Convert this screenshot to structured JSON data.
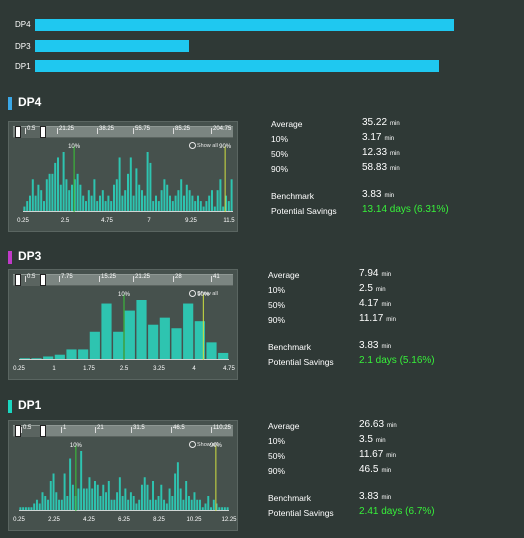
{
  "summary_bars": [
    {
      "label": "DP4",
      "fraction": 1.0
    },
    {
      "label": "DP3",
      "fraction": 0.367
    },
    {
      "label": "DP1",
      "fraction": 0.964
    }
  ],
  "sections": [
    {
      "title": "DP4",
      "color": "#3aa7e6",
      "slider_ticks": [
        "0.5",
        "21.25",
        "38.25",
        "55.75",
        "85.25",
        "204.75"
      ],
      "show_all": "Show all",
      "x_ticks": [
        "0.25",
        "2.5",
        "4.75",
        "7",
        "9.25",
        "11.5"
      ],
      "p10_label": "10%",
      "p90_label": "90%",
      "histogram": [
        1,
        2,
        3,
        6,
        3,
        5,
        4,
        2,
        6,
        7,
        7,
        9,
        10,
        5,
        11,
        6,
        4,
        5,
        6,
        7,
        5,
        3,
        2,
        4,
        3,
        6,
        2,
        3,
        4,
        2,
        3,
        2,
        5,
        6,
        10,
        3,
        4,
        7,
        10,
        3,
        8,
        5,
        4,
        3,
        11,
        9,
        2,
        3,
        2,
        4,
        6,
        5,
        3,
        2,
        3,
        4,
        6,
        3,
        5,
        4,
        3,
        2,
        3,
        2,
        1,
        2,
        3,
        4,
        1,
        4,
        6,
        1,
        3,
        2,
        6
      ],
      "x_min": 0.25,
      "x_max": 12.25,
      "p10_x": 3.17,
      "p90_x": 11.8,
      "stats": {
        "average_label": "Average",
        "average": "35.22",
        "p10_label": "10%",
        "p10": "3.17",
        "p50_label": "50%",
        "p50": "12.33",
        "p90_label": "90%",
        "p90": "58.83",
        "unit": "min",
        "benchmark_label": "Benchmark",
        "benchmark": "3.83",
        "savings_label": "Potential Savings",
        "savings": "13.14 days (6.31%)"
      }
    },
    {
      "title": "DP3",
      "color": "#c03ac8",
      "slider_ticks": [
        "0.5",
        "7.75",
        "15.25",
        "21.25",
        "28",
        "41"
      ],
      "show_all": "Show all",
      "x_ticks": [
        "0.25",
        "1",
        "1.75",
        "2.5",
        "3.25",
        "4",
        "4.75"
      ],
      "p10_label": "10%",
      "p90_label": "90%",
      "histogram": [
        0.5,
        0.5,
        1,
        1.5,
        3,
        3,
        8,
        16,
        8,
        14,
        17,
        10,
        12,
        9,
        16,
        11,
        5,
        2
      ],
      "x_min": 0.25,
      "x_max": 4.75,
      "p10_x": 2.5,
      "p90_x": 4.2,
      "stats": {
        "average_label": "Average",
        "average": "7.94",
        "p10_label": "10%",
        "p10": "2.5",
        "p50_label": "50%",
        "p50": "4.17",
        "p90_label": "90%",
        "p90": "11.17",
        "unit": "min",
        "benchmark_label": "Benchmark",
        "benchmark": "3.83",
        "savings_label": "Potential Savings",
        "savings": "2.1 days (5.16%)"
      }
    },
    {
      "title": "DP1",
      "color": "#1ad6c0",
      "slider_ticks": [
        "0.5",
        "1",
        "21",
        "31.5",
        "46.5",
        "110.25"
      ],
      "show_all": "Show all",
      "x_ticks": [
        "0.25",
        "2.25",
        "4.25",
        "6.25",
        "8.25",
        "10.25",
        "12.25"
      ],
      "p10_label": "10%",
      "p90_label": "90%",
      "histogram": [
        1,
        1,
        1,
        1,
        1,
        2,
        3,
        2,
        5,
        4,
        3,
        8,
        10,
        5,
        3,
        3,
        10,
        4,
        14,
        7,
        4,
        6,
        16,
        6,
        6,
        9,
        6,
        8,
        7,
        4,
        7,
        5,
        8,
        3,
        3,
        5,
        9,
        4,
        6,
        3,
        5,
        4,
        2,
        3,
        7,
        9,
        7,
        3,
        8,
        3,
        4,
        7,
        3,
        2,
        6,
        4,
        10,
        13,
        6,
        3,
        8,
        4,
        3,
        5,
        3,
        3,
        1,
        2,
        4,
        1,
        3,
        2,
        1,
        1,
        1,
        1
      ],
      "x_min": 0.25,
      "x_max": 12.25,
      "p10_x": 3.5,
      "p90_x": 11.5,
      "stats": {
        "average_label": "Average",
        "average": "26.63",
        "p10_label": "10%",
        "p10": "3.5",
        "p50_label": "50%",
        "p50": "11.67",
        "p90_label": "90%",
        "p90": "46.5",
        "unit": "min",
        "benchmark_label": "Benchmark",
        "benchmark": "3.83",
        "savings_label": "Potential Savings",
        "savings": "2.41 days (6.7%)"
      }
    }
  ],
  "colors": {
    "bar": "#1fc8f0",
    "histogram": "#2ec4b0",
    "p10_line": "#38c836",
    "p90_line": "#d0e040",
    "green_text": "#37f03a"
  }
}
